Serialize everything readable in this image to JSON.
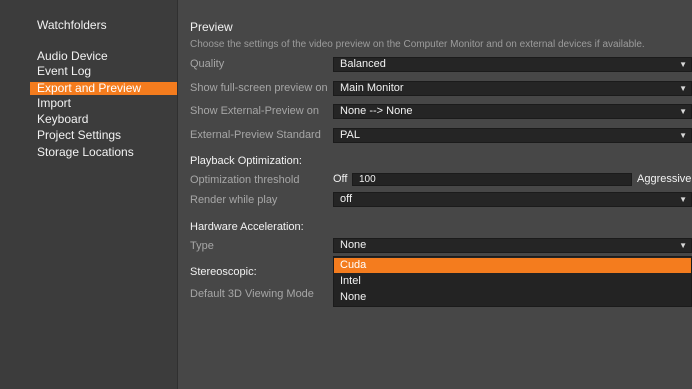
{
  "sidebar": {
    "items": [
      {
        "label": "Watchfolders"
      },
      {
        "label": "Audio Device"
      },
      {
        "label": "Event Log"
      },
      {
        "label": "Export and Preview"
      },
      {
        "label": "Import"
      },
      {
        "label": "Keyboard"
      },
      {
        "label": "Project Settings"
      },
      {
        "label": "Storage Locations"
      }
    ]
  },
  "preview": {
    "title": "Preview",
    "description": "Choose the settings of the video preview on the Computer Monitor and on external devices if available.",
    "quality": {
      "label": "Quality",
      "value": "Balanced"
    },
    "fullscreen": {
      "label": "Show full-screen preview on",
      "value": "Main Monitor"
    },
    "external": {
      "label": "Show External-Preview on",
      "value": "None --> None"
    },
    "standard": {
      "label": "External-Preview Standard",
      "value": "PAL"
    }
  },
  "playback": {
    "title": "Playback Optimization:",
    "threshold": {
      "label": "Optimization threshold",
      "min_label": "Off",
      "value": "100",
      "max_label": "Aggressive"
    },
    "render": {
      "label": "Render while play",
      "value": "off"
    }
  },
  "hardware": {
    "title": "Hardware Acceleration:",
    "type": {
      "label": "Type",
      "value": "None"
    },
    "options": [
      "Cuda",
      "Intel",
      "None"
    ]
  },
  "stereo": {
    "title": "Stereoscopic:",
    "mode": {
      "label": "Default 3D Viewing Mode"
    }
  },
  "colors": {
    "accent": "#f47c1e",
    "background": "#474747",
    "sidebar": "#3c3c3c"
  }
}
